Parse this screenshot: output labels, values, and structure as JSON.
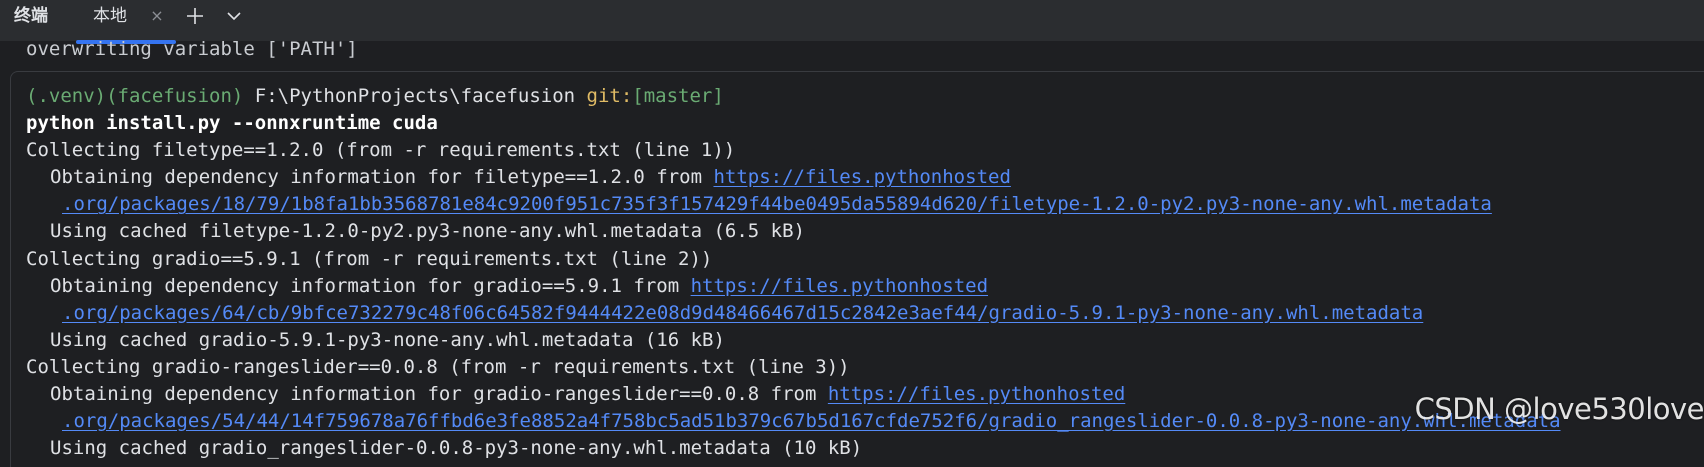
{
  "toolwindow": {
    "title": "终端",
    "tabs": [
      {
        "label": "本地",
        "close_glyph": "×"
      }
    ],
    "new_tab_icon": "plus-icon",
    "dropdown_icon": "chevron-down-icon"
  },
  "terminal": {
    "overwrite_line": "overwriting variable ['PATH']",
    "prompt": {
      "env": "(.venv)(facefusion)",
      "path": " F:\\PythonProjects\\facefusion ",
      "git_label": "git:",
      "branch": "[master]"
    },
    "command": "python install.py --onnxruntime cuda",
    "output": [
      {
        "kind": "text",
        "indent": 0,
        "text": "Collecting filetype==1.2.0 (from -r requirements.txt (line 1))"
      },
      {
        "kind": "prelink",
        "indent": 2,
        "text": "Obtaining dependency information for filetype==1.2.0 from ",
        "link": "https://files.pythonhosted"
      },
      {
        "kind": "link",
        "indent": 3,
        "link": ".org/packages/18/79/1b8fa1bb3568781e84c9200f951c735f3f157429f44be0495da55894d620/filetype-1.2.0-py2.py3-none-any.whl.metadata"
      },
      {
        "kind": "text",
        "indent": 2,
        "text": "Using cached filetype-1.2.0-py2.py3-none-any.whl.metadata (6.5 kB)"
      },
      {
        "kind": "text",
        "indent": 0,
        "text": "Collecting gradio==5.9.1 (from -r requirements.txt (line 2))"
      },
      {
        "kind": "prelink",
        "indent": 2,
        "text": "Obtaining dependency information for gradio==5.9.1 from ",
        "link": "https://files.pythonhosted"
      },
      {
        "kind": "link",
        "indent": 3,
        "link": ".org/packages/64/cb/9bfce732279c48f06c64582f9444422e08d9d48466467d15c2842e3aef44/gradio-5.9.1-py3-none-any.whl.metadata"
      },
      {
        "kind": "text",
        "indent": 2,
        "text": "Using cached gradio-5.9.1-py3-none-any.whl.metadata (16 kB)"
      },
      {
        "kind": "text",
        "indent": 0,
        "text": "Collecting gradio-rangeslider==0.0.8 (from -r requirements.txt (line 3))"
      },
      {
        "kind": "prelink",
        "indent": 2,
        "text": "Obtaining dependency information for gradio-rangeslider==0.0.8 from ",
        "link": "https://files.pythonhosted"
      },
      {
        "kind": "link",
        "indent": 3,
        "link": ".org/packages/54/44/14f759678a76ffbd6e3fe8852a4f758bc5ad51b379c67b5d167cfde752f6/gradio_rangeslider-0.0.8-py3-none-any.whl.metadata"
      },
      {
        "kind": "text",
        "indent": 2,
        "text": "Using cached gradio_rangeslider-0.0.8-py3-none-any.whl.metadata (10 kB)"
      }
    ]
  },
  "watermark": "CSDN @love530love",
  "colors": {
    "background": "#1e1f22",
    "tabbar": "#2b2d30",
    "accent": "#3574f0",
    "link": "#548af7",
    "env_green": "#6aab73",
    "git_yellow": "#e0bb65"
  }
}
